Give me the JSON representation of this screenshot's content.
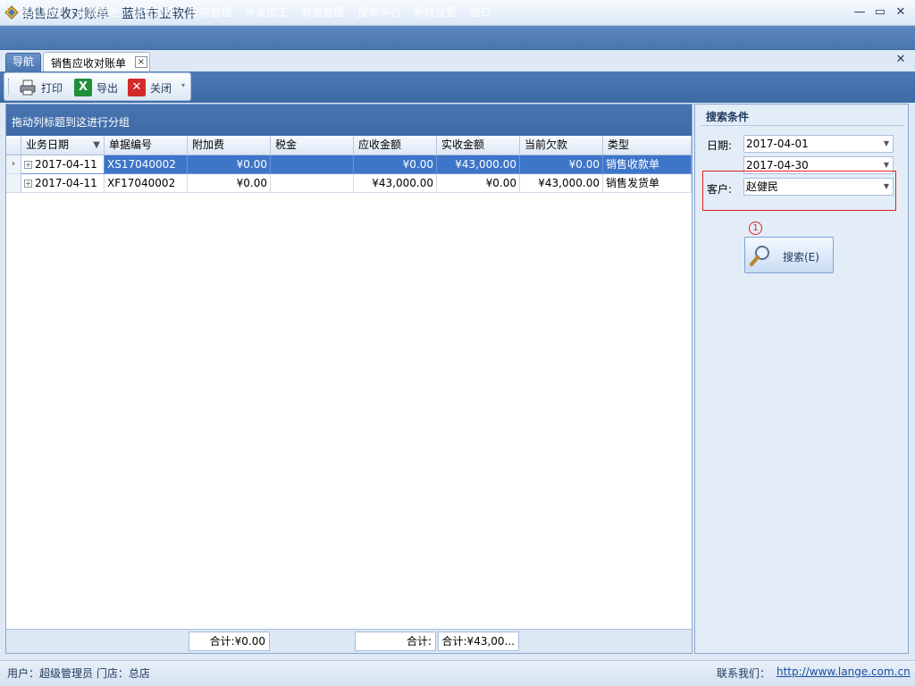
{
  "window": {
    "title": "销售应收对账单 - 蓝格布业软件"
  },
  "menu": [
    "基础资料",
    "采购管理",
    "销售管理",
    "库存管理",
    "外发加工",
    "财务管理",
    "报表中心",
    "系统设置",
    "窗口"
  ],
  "tabs": {
    "nav_label": "导航",
    "doc_label": "销售应收对账单",
    "close_glyph": "×"
  },
  "toolbar": {
    "print_label": "打印",
    "export_label": "导出",
    "close_label": "关闭"
  },
  "grid": {
    "group_hint": "拖动列标题到这进行分组",
    "columns": [
      "业务日期",
      "单据编号",
      "附加费",
      "税金",
      "应收金额",
      "实收金额",
      "当前欠款",
      "类型"
    ],
    "rows": [
      {
        "date": "2017-04-11",
        "doc_no": "XS17040002",
        "surcharge": "¥0.00",
        "tax": "",
        "receivable": "¥0.00",
        "received": "¥43,000.00",
        "balance": "¥0.00",
        "type": "销售收款单"
      },
      {
        "date": "2017-04-11",
        "doc_no": "XF17040002",
        "surcharge": "¥0.00",
        "tax": "",
        "receivable": "¥43,000.00",
        "received": "¥0.00",
        "balance": "¥43,000.00",
        "type": "销售发货单"
      }
    ],
    "totals": {
      "surcharge": "合计:¥0.00",
      "receivable": "合计:",
      "received": "合计:¥43,00..."
    }
  },
  "search": {
    "title": "搜索条件",
    "date_label": "日期:",
    "date_from": "2017-04-01",
    "date_to": "2017-04-30",
    "customer_label": "客户:",
    "customer_value": "赵健民",
    "step_marker": "1",
    "button_label": "搜索(E)"
  },
  "status": {
    "user_text": "用户：超级管理员  门店：总店",
    "contact_label": "联系我们：",
    "url": "http://www.lange.com.cn"
  },
  "colors": {
    "accent": "#4a76b0",
    "selection": "#3d75c9",
    "highlight": "#e02020"
  }
}
